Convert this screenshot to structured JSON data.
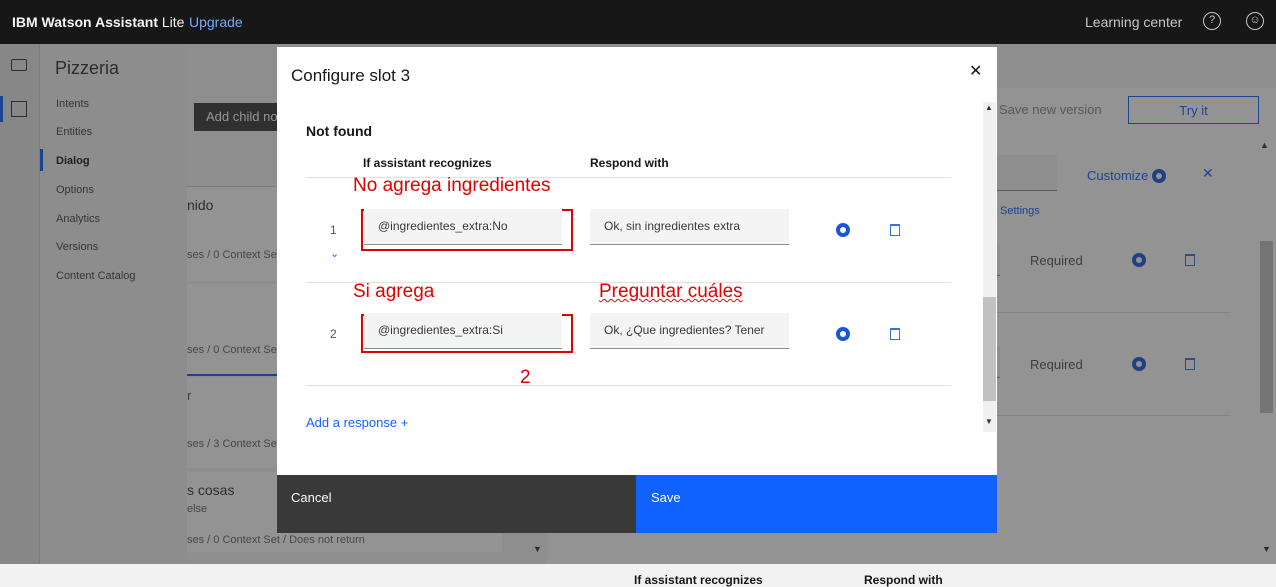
{
  "topbar": {
    "brand_bold": "IBM Watson Assistant",
    "brand_light": "Lite",
    "upgrade": "Upgrade",
    "learning_center": "Learning center"
  },
  "nav": {
    "title": "Pizzeria",
    "items": [
      "Intents",
      "Entities",
      "Dialog",
      "Options",
      "Analytics",
      "Versions",
      "Content Catalog"
    ],
    "active": "Dialog"
  },
  "background": {
    "add_child": "Add child no",
    "node_texts": [
      "nido",
      "ses / 0 Context Set",
      "ses / 0 Context Set",
      "r",
      "ses / 3 Context Set",
      "s cosas",
      "else",
      "ses / 0 Context Set / Does not return"
    ],
    "save_version": "Save new version",
    "try_it": "Try it",
    "customize": "Customize",
    "settings": "Settings",
    "required": [
      "Required",
      "Required"
    ],
    "bottom_headers": [
      "If assistant recognizes",
      "Respond with"
    ]
  },
  "modal": {
    "title": "Configure slot 3",
    "section": "Not found",
    "col_recognizes": "If assistant recognizes",
    "col_respond": "Respond with",
    "rows": [
      {
        "num": "1",
        "condition": "@ingredientes_extra:No",
        "response": "Ok, sin ingredientes extra"
      },
      {
        "num": "2",
        "condition": "@ingredientes_extra:Si",
        "response": "Ok, ¿Que ingredientes? Tener"
      }
    ],
    "add_response": "Add a response",
    "cancel": "Cancel",
    "save": "Save"
  },
  "annotations": {
    "a1": "No agrega ingredientes",
    "a2": "Si agrega",
    "a3": "Preguntar cuáles",
    "a4": "2"
  },
  "colors": {
    "accent": "#0f62fe",
    "annotation": "#e00000",
    "topbar": "#171717"
  }
}
